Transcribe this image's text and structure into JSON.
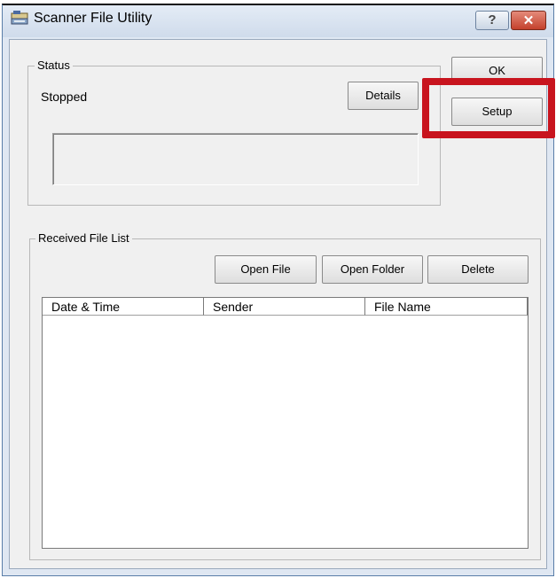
{
  "window": {
    "title": "Scanner File Utility",
    "help_glyph": "?",
    "close_glyph": "✕"
  },
  "buttons": {
    "ok": "OK",
    "setup": "Setup"
  },
  "status": {
    "group_label": "Status",
    "state": "Stopped",
    "details_button": "Details"
  },
  "received": {
    "group_label": "Received File List",
    "open_file_button": "Open File",
    "open_folder_button": "Open Folder",
    "delete_button": "Delete",
    "columns": [
      "Date & Time",
      "Sender",
      "File Name"
    ]
  },
  "colors": {
    "highlight": "#c8141e"
  }
}
